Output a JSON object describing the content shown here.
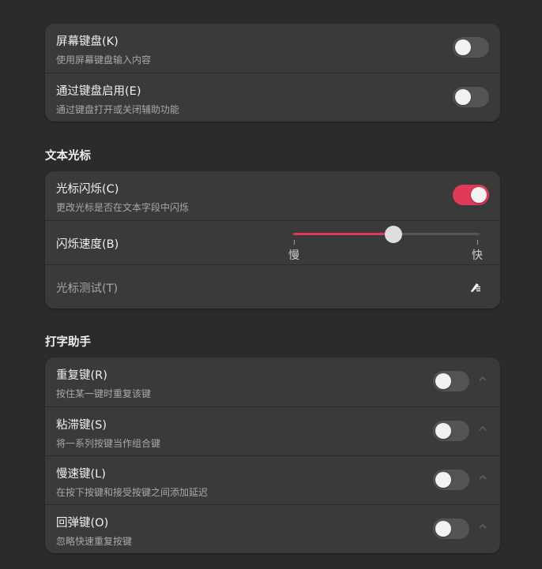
{
  "top_card": {
    "items": [
      {
        "title": "屏幕键盘(K)",
        "subtitle": "使用屏幕键盘输入内容",
        "enabled": false
      },
      {
        "title": "通过键盘启用(E)",
        "subtitle": "通过键盘打开或关闭辅助功能",
        "enabled": false
      }
    ]
  },
  "cursor_section": {
    "heading": "文本光标",
    "blink": {
      "title": "光标闪烁(C)",
      "subtitle": "更改光标是否在文本字段中闪烁",
      "enabled": true
    },
    "speed": {
      "title": "闪烁速度(B)",
      "value": 0.54,
      "min_label": "慢",
      "max_label": "快"
    },
    "test": {
      "placeholder": "光标测试(T)",
      "icon": "edit-clear-icon"
    }
  },
  "typing_section": {
    "heading": "打字助手",
    "items": [
      {
        "title": "重复键(R)",
        "subtitle": "按住某一键时重复该键",
        "enabled": false
      },
      {
        "title": "粘滞键(S)",
        "subtitle": "将一系列按键当作组合键",
        "enabled": false
      },
      {
        "title": "慢速键(L)",
        "subtitle": "在按下按键和接受按键之间添加延迟",
        "enabled": false
      },
      {
        "title": "回弹键(O)",
        "subtitle": "忽略快速重复按键",
        "enabled": false
      }
    ]
  },
  "colors": {
    "accent": "#e0395a",
    "background": "#2b2b2b",
    "card": "#3a3a3a"
  }
}
